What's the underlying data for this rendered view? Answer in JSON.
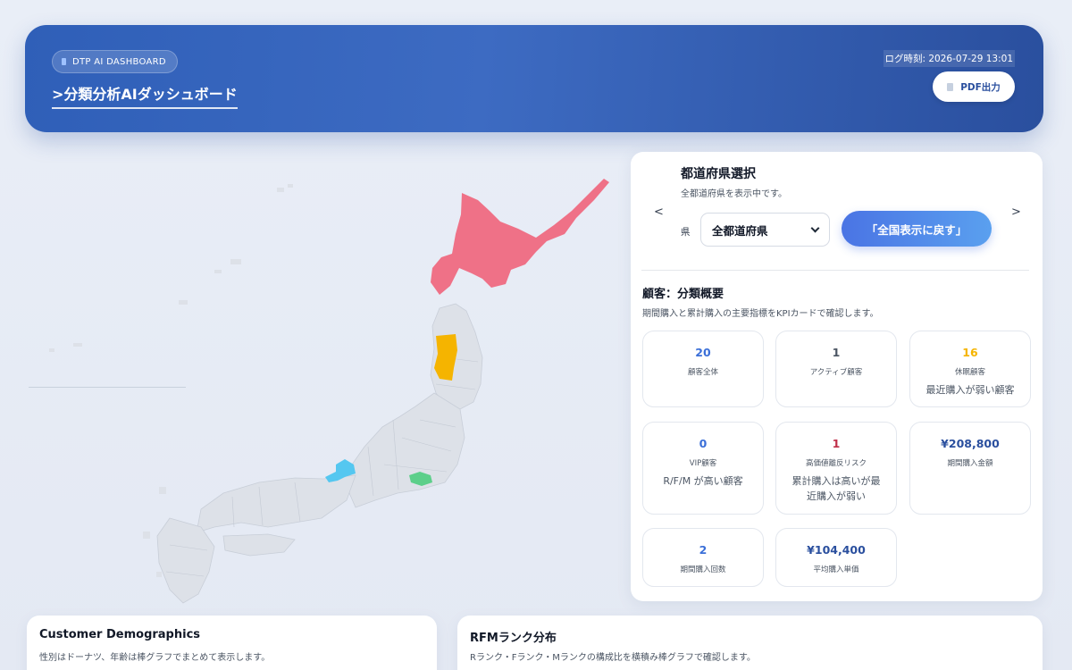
{
  "header": {
    "badge": "DTP AI DASHBOARD",
    "title": ">分類分析AIダッシュボード",
    "log_time": "ログ時刻: 2026-07-29 13:01",
    "pdf_button": "PDF出力"
  },
  "prefecture": {
    "title": "都道府県選択",
    "subtitle": "全都道府県を表示中です。",
    "label": "県",
    "selected": "全都道府県",
    "reset_button": "「全国表示に戻す」",
    "prev": "<",
    "next": ">"
  },
  "map": {
    "highlighted": [
      {
        "name": "hokkaido",
        "color": "#ef7187"
      },
      {
        "name": "akita",
        "color": "#f5b400"
      },
      {
        "name": "fukui",
        "color": "#55c7f0"
      },
      {
        "name": "tokyo",
        "color": "#5ccf8a"
      }
    ],
    "base_color": "#dde1e8"
  },
  "summary": {
    "title": "顧客：分類概要",
    "subtitle": "期間購入と累計購入の主要指標をKPIカードで確認します。",
    "cards": [
      {
        "value": "20",
        "label": "顧客全体",
        "note": "",
        "color": "#3b6fd8"
      },
      {
        "value": "1",
        "label": "アクティブ顧客",
        "note": "",
        "color": "#4b5563"
      },
      {
        "value": "16",
        "label": "休眠顧客",
        "note": "最近購入が弱い顧客",
        "color": "#f5b400"
      },
      {
        "value": "0",
        "label": "VIP顧客",
        "note": "R/F/M が高い顧客",
        "color": "#3b6fd8"
      },
      {
        "value": "1",
        "label": "高価値離反リスク",
        "note": "累計購入は高いが最近購入が弱い",
        "color": "#c0304a"
      },
      {
        "value": "¥208,800",
        "label": "期間購入金額",
        "note": "",
        "color": "#2a4f9e"
      },
      {
        "value": "2",
        "label": "期間購入回数",
        "note": "",
        "color": "#3b6fd8"
      },
      {
        "value": "¥104,400",
        "label": "平均購入単価",
        "note": "",
        "color": "#2a4f9e"
      }
    ]
  },
  "demographics": {
    "title": "Customer Demographics",
    "subtitle": "性別はドーナツ、年齢は棒グラフでまとめて表示します。"
  },
  "rfm": {
    "title": "RFMランク分布",
    "subtitle": "Rランク・Fランク・Mランクの構成比を横積み棒グラフで確認します。"
  }
}
